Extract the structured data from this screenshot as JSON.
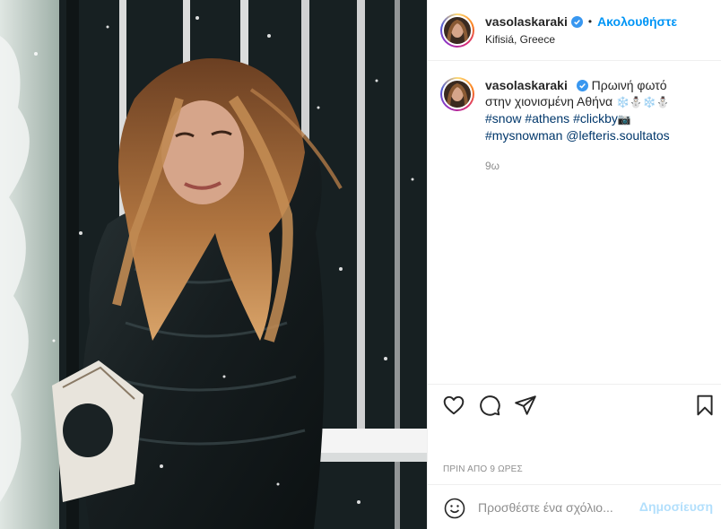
{
  "post": {
    "username": "vasolaskaraki",
    "follow_label": "Ακολουθήστε",
    "dot": "•",
    "location": "Kifisiá, Greece",
    "caption_text": "Πρωινή φωτό στην χιονισμένη Αθήνα",
    "caption_emojis": "❄️⛄❄️⛄",
    "hashtags": [
      "#snow",
      "#athens",
      "#clickby",
      "#mysnowman"
    ],
    "hashtag_suffix_emoji": "📷",
    "mention": "@lefteris.soultatos",
    "relative_time": "9ω",
    "date_label": "ΠΡΙΝ ΑΠΟ 9 ΩΡΕΣ"
  },
  "comment": {
    "placeholder": "Προσθέστε ένα σχόλιο...",
    "post_label": "Δημοσίευση"
  },
  "icons": {
    "verified": "verified-badge-icon",
    "like": "heart-icon",
    "comment": "comment-bubble-icon",
    "share": "paper-plane-icon",
    "save": "bookmark-icon",
    "emoji": "smiley-icon"
  },
  "colors": {
    "accent": "#0095f6",
    "link": "#00376b",
    "muted": "#8e8e8e",
    "post_disabled": "#b2dffc"
  }
}
